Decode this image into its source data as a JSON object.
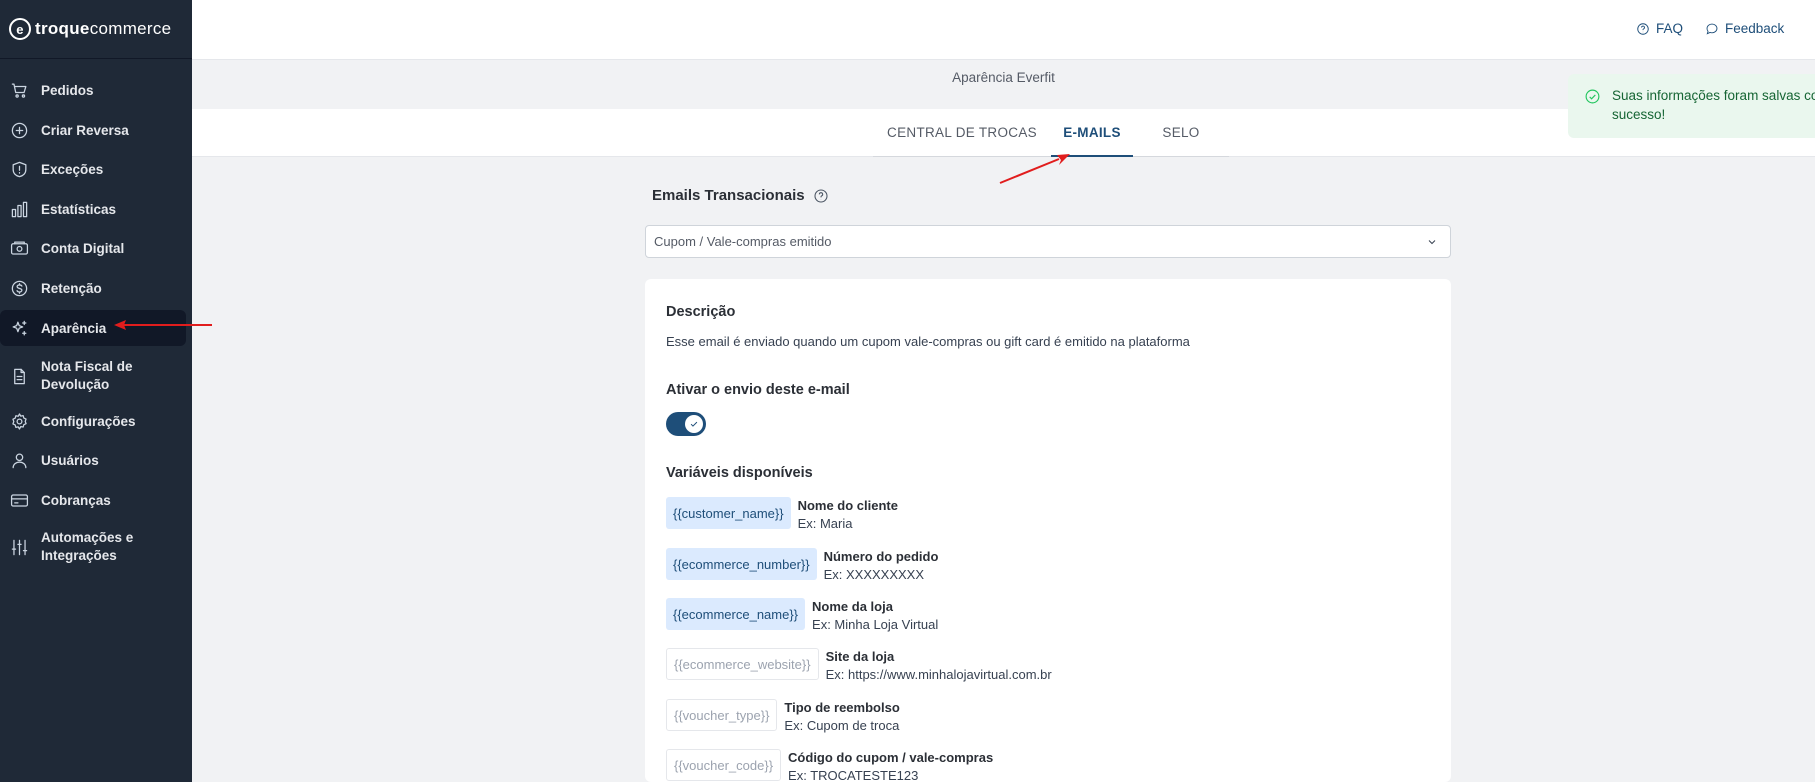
{
  "app": {
    "logo_letter": "e",
    "logo_bold": "troque",
    "logo_rest": "commerce"
  },
  "sidebar": {
    "items": [
      {
        "label": "Pedidos",
        "icon": "cart-icon"
      },
      {
        "label": "Criar Reversa",
        "icon": "plus-circle-icon"
      },
      {
        "label": "Exceções",
        "icon": "shield-alert-icon"
      },
      {
        "label": "Estatísticas",
        "icon": "bar-chart-icon"
      },
      {
        "label": "Conta Digital",
        "icon": "banknote-icon"
      },
      {
        "label": "Retenção",
        "icon": "dollar-circle-icon"
      },
      {
        "label": "Aparência",
        "icon": "sparkles-icon",
        "active": true
      },
      {
        "label": "Nota Fiscal de Devolução",
        "icon": "file-icon"
      },
      {
        "label": "Configurações",
        "icon": "gear-icon"
      },
      {
        "label": "Usuários",
        "icon": "user-icon"
      },
      {
        "label": "Cobranças",
        "icon": "credit-card-icon"
      },
      {
        "label": "Automações e Integrações",
        "icon": "sliders-icon"
      }
    ]
  },
  "header": {
    "faq_label": "FAQ",
    "feedback_label": "Feedback"
  },
  "page": {
    "subtitle": "Aparência Everfit"
  },
  "tabs": [
    {
      "label": "CENTRAL DE TROCAS",
      "active": false
    },
    {
      "label": "E-MAILS",
      "active": true
    },
    {
      "label": "SELO",
      "active": false
    }
  ],
  "toast": {
    "message": "Suas informações foram salvas com sucesso!",
    "line1": "Suas informações foram salvas co",
    "line2": "sucesso!"
  },
  "emails": {
    "section_title": "Emails Transacionais",
    "selected_email": "Cupom / Vale-compras emitido",
    "description_title": "Descrição",
    "description_text": "Esse email é enviado quando um cupom vale-compras ou gift card é emitido na plataforma",
    "toggle_title": "Ativar o envio deste e-mail",
    "toggle_on": true,
    "variables_title": "Variáveis disponíveis",
    "variables": [
      {
        "token": "{{customer_name}}",
        "title": "Nome do cliente",
        "example": "Ex: Maria",
        "enabled": true
      },
      {
        "token": "{{ecommerce_number}}",
        "title": "Número do pedido",
        "example": "Ex: XXXXXXXXX",
        "enabled": true
      },
      {
        "token": "{{ecommerce_name}}",
        "title": "Nome da loja",
        "example": "Ex: Minha Loja Virtual",
        "enabled": true
      },
      {
        "token": "{{ecommerce_website}}",
        "title": "Site da loja",
        "example": "Ex: https://www.minhalojavirtual.com.br",
        "enabled": false
      },
      {
        "token": "{{voucher_type}}",
        "title": "Tipo de reembolso",
        "example": "Ex: Cupom de troca",
        "enabled": false
      },
      {
        "token": "{{voucher_code}}",
        "title": "Código do cupom / vale-compras",
        "example": "Ex: TROCATESTE123",
        "enabled": false
      }
    ]
  },
  "colors": {
    "sidebar_bg": "#1f2937",
    "accent": "#1e4e79",
    "chip_active_bg": "#dbeafe",
    "annotation_arrow": "#e11d1d",
    "toast_bg": "#eaf7ee"
  }
}
